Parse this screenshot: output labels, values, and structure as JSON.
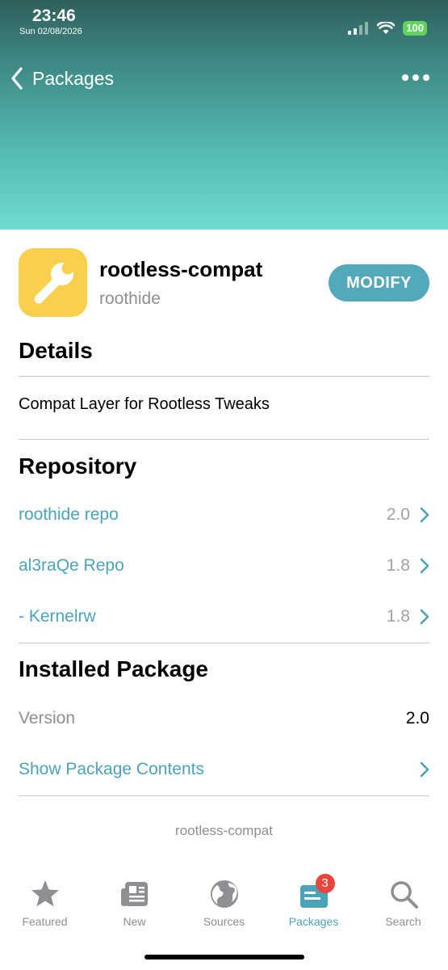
{
  "status_bar": {
    "time": "23:46",
    "date": "Sun 02/08/2026",
    "battery": "100"
  },
  "nav": {
    "back_label": "Packages"
  },
  "package": {
    "name": "rootless-compat",
    "author": "roothide",
    "action_label": "MODIFY"
  },
  "details": {
    "title": "Details",
    "description": "Compat Layer for Rootless Tweaks"
  },
  "repository": {
    "title": "Repository",
    "items": [
      {
        "name": "roothide repo",
        "version": "2.0"
      },
      {
        "name": "al3raQe Repo",
        "version": "1.8"
      },
      {
        "name": "- Kernelrw",
        "version": "1.8"
      }
    ]
  },
  "installed": {
    "title": "Installed Package",
    "version_label": "Version",
    "version_value": "2.0",
    "contents_label": "Show Package Contents"
  },
  "footer": {
    "text": "rootless-compat"
  },
  "tabs": [
    {
      "label": "Featured",
      "icon": "star-icon"
    },
    {
      "label": "New",
      "icon": "newspaper-icon"
    },
    {
      "label": "Sources",
      "icon": "globe-icon"
    },
    {
      "label": "Packages",
      "icon": "packages-icon",
      "badge": "3"
    },
    {
      "label": "Search",
      "icon": "search-icon"
    }
  ],
  "colors": {
    "accent": "#4ba3b8",
    "button": "#53a8ba",
    "icon_bg": "#f9d04d",
    "badge": "#e8453c",
    "battery": "#5fd35c"
  }
}
